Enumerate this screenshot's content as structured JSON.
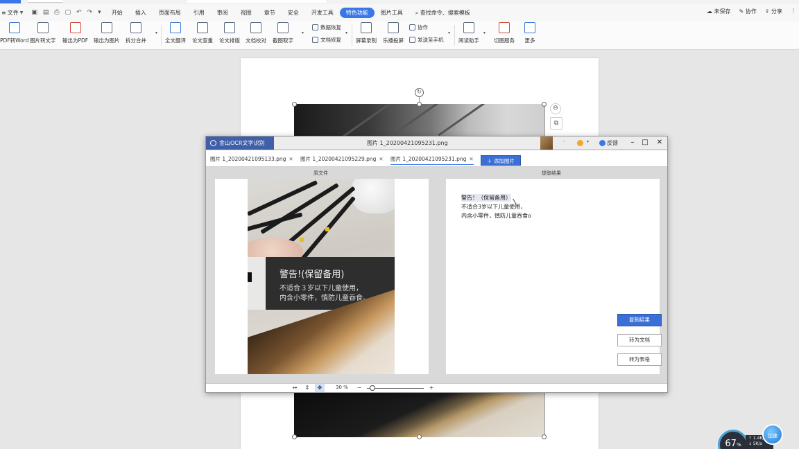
{
  "menubar": {
    "file_label": "文件",
    "tabs": [
      "开始",
      "插入",
      "页面布局",
      "引用",
      "审阅",
      "视图",
      "章节",
      "安全",
      "开发工具",
      "特色功能",
      "图片工具"
    ],
    "active_tab": "特色功能",
    "search_label": "查找命令、搜索模板",
    "unsaved_label": "未保存",
    "collab_label": "协作",
    "share_label": "分享"
  },
  "toolbar": {
    "pdf_to_word": "PDF转Word",
    "img_to_text": "图片转文字",
    "export_pdf": "输出为PDF",
    "export_img": "输出为图片",
    "split_merge": "拆分合并",
    "full_translate": "全文翻译",
    "paper_check": "论文查重",
    "paper_format": "论文排版",
    "doc_correct": "文档校对",
    "screenshot_ocr": "截图取字",
    "data_recovery": "数据恢复",
    "doc_repair": "文档修复",
    "screen_record": "屏幕录制",
    "cast_screen": "乐播投屏",
    "collaborate": "协作",
    "send_phone": "发送至手机",
    "reading_helper": "阅读助手",
    "career_assist": "切图服务",
    "more": "更多"
  },
  "ocr": {
    "app_name": "金山OCR文字识别",
    "window_title": "图片 1_20200421095231.png",
    "feedback_label": "反馈",
    "tabs": [
      {
        "label": "图片 1_20200421095133.png"
      },
      {
        "label": "图片 1_20200421095229.png"
      },
      {
        "label": "图片 1_20200421095231.png"
      }
    ],
    "add_image_label": "添加图片",
    "source_header": "原文件",
    "result_header": "提取结果",
    "photo_text": {
      "line1": "警告!(保留备用)",
      "line2": "不适合３岁以下儿童使用，",
      "line3": "内含小零件，慎防儿童吞食。"
    },
    "result_lines": [
      "警告！（保留备用）",
      "不适合3岁以下儿童使用，",
      "内含小零件，慎防儿童吞食o"
    ],
    "copy_button": "复制结果",
    "to_doc_button": "转为文档",
    "to_table_button": "转为表格",
    "zoom_level": "30 %"
  },
  "widgets": {
    "speed_value": "67",
    "speed_unit": "%",
    "speed_up": "↑ 1.4K/s",
    "speed_down": "↓ 5K/s",
    "assistant_label": "加速"
  },
  "colors": {
    "accent": "#3b78e7",
    "ocr_brand": "#3f5fa8",
    "primary_button": "#3b6fd6"
  }
}
